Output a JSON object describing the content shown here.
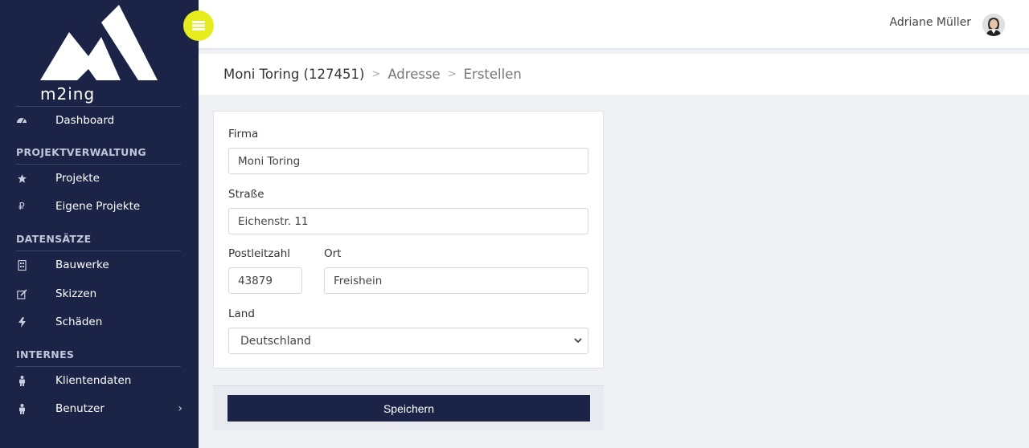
{
  "brand": {
    "name": "m2ing"
  },
  "sidebar": {
    "dashboard": "Dashboard",
    "sections": {
      "projekt": "PROJEKTVERWALTUNG",
      "daten": "DATENSÄTZE",
      "intern": "INTERNES"
    },
    "items": {
      "projekte": "Projekte",
      "eigene_projekte": "Eigene Projekte",
      "bauwerke": "Bauwerke",
      "skizzen": "Skizzen",
      "schaeden": "Schäden",
      "klientendaten": "Klientendaten",
      "benutzer": "Benutzer"
    }
  },
  "header": {
    "user_name": "Adriane Müller"
  },
  "breadcrumb": {
    "main": "Moni Toring (127451)",
    "sep": ">",
    "level1": "Adresse",
    "level2": "Erstellen"
  },
  "form": {
    "firma_label": "Firma",
    "firma_value": "Moni Toring",
    "strasse_label": "Straße",
    "strasse_value": "Eichenstr. 11",
    "plz_label": "Postleitzahl",
    "plz_value": "43879",
    "ort_label": "Ort",
    "ort_value": "Freishein",
    "land_label": "Land",
    "land_value": "Deutschland",
    "save_label": "Speichern"
  },
  "colors": {
    "sidebar": "#1b2447",
    "accent": "#e6ec1e",
    "background": "#f0f1f5"
  }
}
